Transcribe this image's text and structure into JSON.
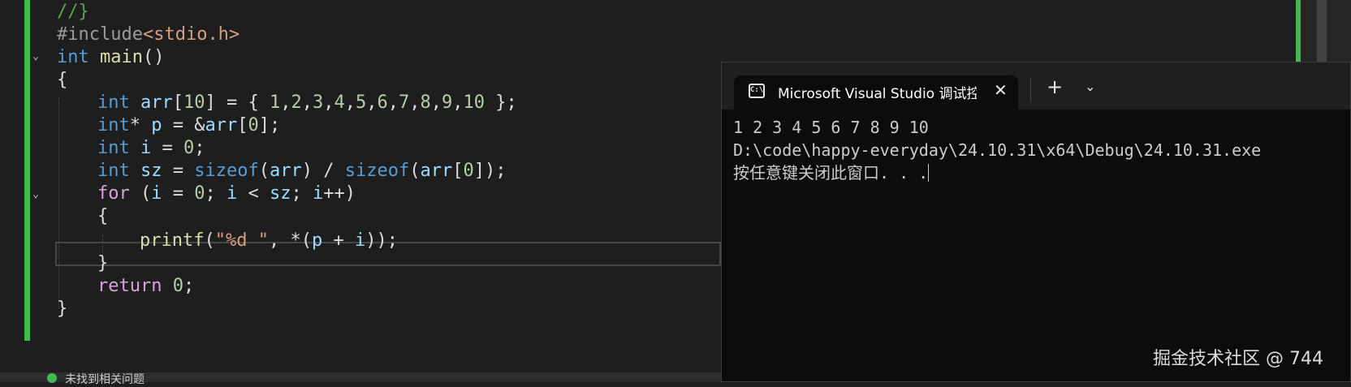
{
  "editor": {
    "lines": [
      {
        "t": "//}"
      },
      {
        "t": "#include<stdio.h>"
      },
      {
        "t": "int main()"
      },
      {
        "t": "{"
      },
      {
        "t": "int arr[10] = { 1,2,3,4,5,6,7,8,9,10 };"
      },
      {
        "t": "int* p = &arr[0];"
      },
      {
        "t": "int i = 0;"
      },
      {
        "t": "int sz = sizeof(arr) / sizeof(arr[0]);"
      },
      {
        "t": "for (i = 0; i < sz; i++)"
      },
      {
        "t": "{"
      },
      {
        "t": "printf(\"%d \", *(p + i));"
      },
      {
        "t": "}"
      },
      {
        "t": "return 0;"
      },
      {
        "t": "}"
      }
    ]
  },
  "status": {
    "message": "未找到相关问题"
  },
  "terminal": {
    "tab_title": "Microsoft Visual Studio 调试控制台",
    "close_glyph": "✕",
    "new_tab_glyph": "+",
    "dropdown_glyph": "⌄",
    "output": [
      "1 2 3 4 5 6 7 8 9 10",
      "D:\\code\\happy-everyday\\24.10.31\\x64\\Debug\\24.10.31.exe",
      "按任意键关闭此窗口. . ."
    ]
  },
  "watermark": "掘金技术社区 @ 744",
  "colors": {
    "keyword": "#569cd6",
    "function": "#dcdcaa",
    "variable": "#9cdcfe",
    "number": "#b5cea8",
    "string": "#d69d85",
    "comment": "#57a64a",
    "change_bar": "#3fb950"
  }
}
